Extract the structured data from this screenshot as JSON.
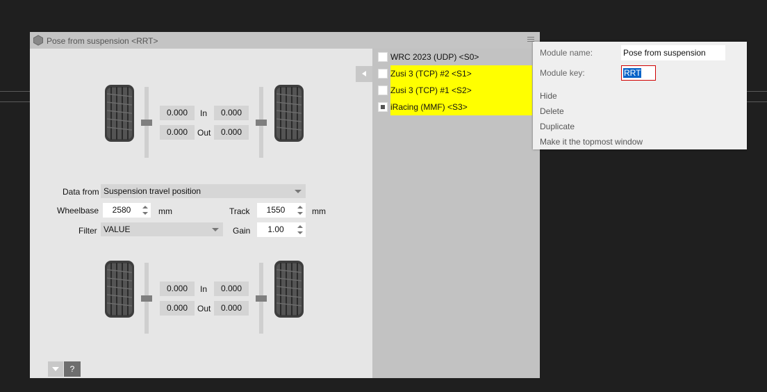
{
  "window": {
    "title": "Pose from suspension <RRT>"
  },
  "front": {
    "in_left": "0.000",
    "in_label": "In",
    "in_right": "0.000",
    "out_left": "0.000",
    "out_label": "Out",
    "out_right": "0.000"
  },
  "rear": {
    "in_left": "0.000",
    "in_label": "In",
    "in_right": "0.000",
    "out_left": "0.000",
    "out_label": "Out",
    "out_right": "0.000"
  },
  "settings": {
    "data_from_label": "Data from",
    "data_from_value": "Suspension travel position",
    "wheelbase_label": "Wheelbase",
    "wheelbase_value": "2580",
    "wheelbase_unit": "mm",
    "track_label": "Track",
    "track_value": "1550",
    "track_unit": "mm",
    "filter_label": "Filter",
    "filter_value": "VALUE",
    "gain_label": "Gain",
    "gain_value": "1.00"
  },
  "bottom": {
    "help_label": "?"
  },
  "sources": [
    {
      "name": "WRC 2023 (UDP) <S0>",
      "checked": false,
      "highlight": false
    },
    {
      "name": "Zusi 3 (TCP) #2 <S1>",
      "checked": false,
      "highlight": true
    },
    {
      "name": "Zusi 3 (TCP) #1 <S2>",
      "checked": false,
      "highlight": true
    },
    {
      "name": "iRacing (MMF) <S3>",
      "checked": true,
      "highlight": true
    }
  ],
  "colors": {
    "highlight": "#ffff00",
    "key_border": "#d00000",
    "selection": "#0a64c8"
  },
  "context_menu": {
    "module_name_label": "Module name:",
    "module_name_value": "Pose from suspension",
    "module_key_label": "Module key:",
    "module_key_value": "RRT",
    "items": [
      "Hide",
      "Delete",
      "Duplicate",
      "Make it the topmost window"
    ]
  }
}
